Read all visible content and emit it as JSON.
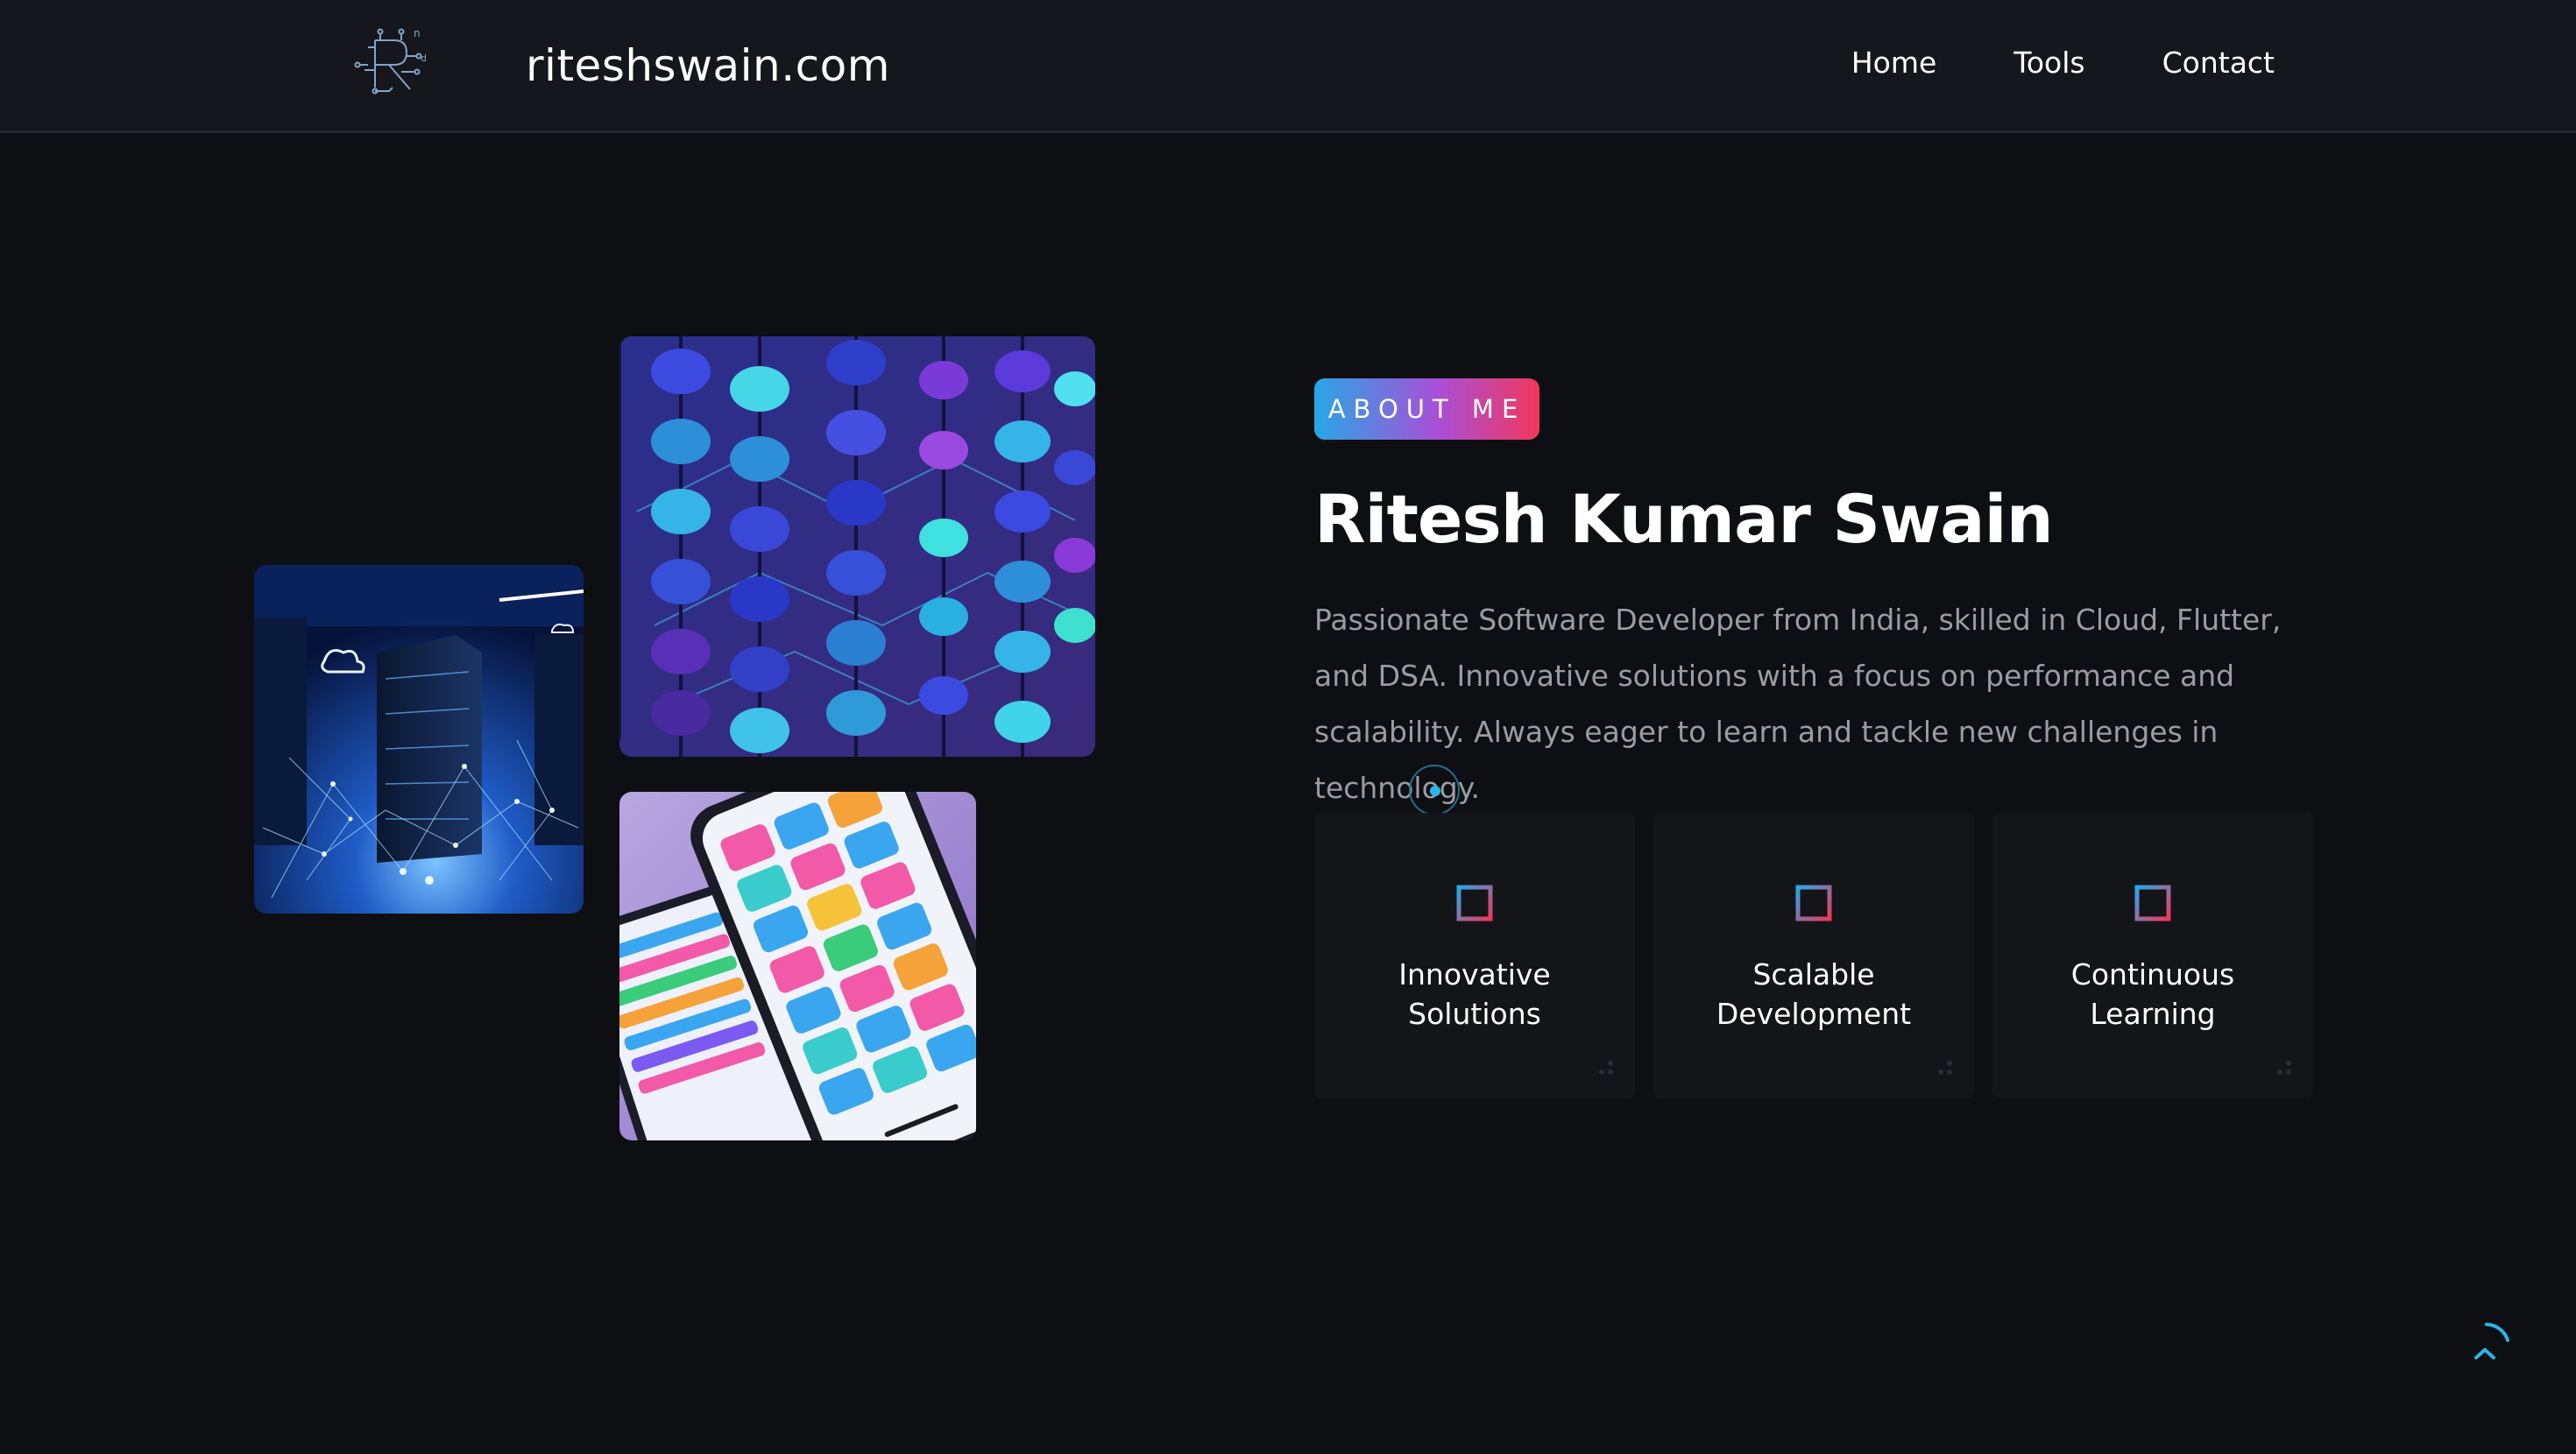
{
  "header": {
    "site_name": "riteshswain.com",
    "logo_icon": "circuit-r-logo",
    "nav": [
      {
        "label": "Home"
      },
      {
        "label": "Tools"
      },
      {
        "label": "Contact"
      }
    ]
  },
  "images": {
    "server": "cloud-server-image",
    "abacus": "abacus-dsa-image",
    "phone": "flutter-app-phone-image"
  },
  "about": {
    "badge": "ABOUT ME",
    "name": "Ritesh Kumar Swain",
    "description": "Passionate Software Developer from India, skilled in Cloud, Flutter, and DSA. Innovative solutions with a focus on performance and scalability. Always eager to learn and tackle new challenges in technology.",
    "features": [
      {
        "line1": "Innovative",
        "line2": "Solutions",
        "icon": "square-icon"
      },
      {
        "line1": "Scalable",
        "line2": "Development",
        "icon": "square-icon"
      },
      {
        "line1": "Continuous",
        "line2": "Learning",
        "icon": "square-icon"
      }
    ]
  },
  "colors": {
    "background": "#0e0f12",
    "header": "#15171c",
    "accent_blue": "#27a7e6",
    "accent_pink": "#f0385b",
    "muted_text": "#9a9ca3"
  },
  "scroll_top_icon": "chevron-up-icon"
}
